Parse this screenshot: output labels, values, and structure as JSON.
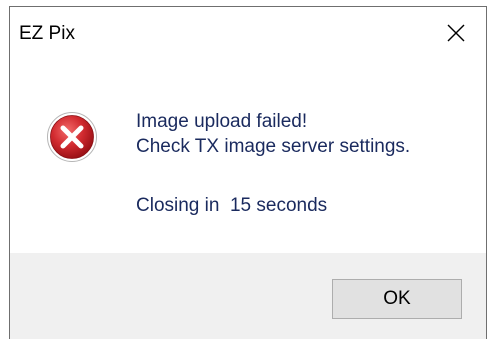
{
  "window": {
    "title": "EZ Pix",
    "close_icon": "close-icon"
  },
  "dialog": {
    "icon": "error-icon",
    "message_line1": "Image upload failed!",
    "message_line2": "Check TX image server settings.",
    "countdown_text": "Closing in  15 seconds",
    "ok_label": "OK"
  },
  "colors": {
    "error_red": "#c0242e",
    "message_text": "#1a2a5e",
    "footer_bg": "#f0f0f0",
    "button_bg": "#e1e1e1"
  }
}
